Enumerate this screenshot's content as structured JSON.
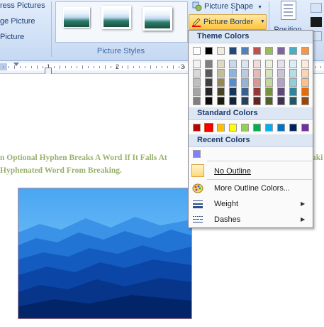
{
  "ribbon": {
    "left_commands": [
      "ress Pictures",
      "ge Picture",
      "Picture"
    ],
    "group_label": "Picture Styles",
    "picture_shape_label": "Picture Shape",
    "picture_border_label": "Picture Border",
    "position_label": "Position"
  },
  "ruler": {
    "numbers": [
      "1",
      "2",
      "3"
    ]
  },
  "document": {
    "line1": "n Optional Hyphen Breaks A Word If It Falls At",
    "line1_tail": "aki",
    "line2": "Hyphenated Word From Breaking.",
    "text_color": "#98b06e"
  },
  "menu": {
    "theme_header": "Theme Colors",
    "standard_header": "Standard Colors",
    "recent_header": "Recent Colors",
    "no_outline": "No Outline",
    "more_colors": "More Outline Colors...",
    "weight": "Weight",
    "dashes": "Dashes",
    "theme_base": [
      "#ffffff",
      "#000000",
      "#eeece1",
      "#1f497d",
      "#4f81bd",
      "#c0504d",
      "#9bbb59",
      "#8064a2",
      "#4bacc6",
      "#f79646"
    ],
    "theme_shades": [
      [
        "#f2f2f2",
        "#d8d8d8",
        "#bfbfbf",
        "#a5a5a5",
        "#7f7f7f"
      ],
      [
        "#7f7f7f",
        "#595959",
        "#3f3f3f",
        "#262626",
        "#0c0c0c"
      ],
      [
        "#ddd9c3",
        "#c4bd97",
        "#938953",
        "#494429",
        "#1d1b10"
      ],
      [
        "#c6d9f0",
        "#8db3e2",
        "#548dd4",
        "#17365d",
        "#0f243e"
      ],
      [
        "#dbe5f1",
        "#b8cce4",
        "#95b3d7",
        "#366092",
        "#244061"
      ],
      [
        "#f2dcdb",
        "#e5b9b7",
        "#d99694",
        "#953734",
        "#632423"
      ],
      [
        "#ebf1dd",
        "#d7e3bc",
        "#c3d69b",
        "#76923c",
        "#4f6128"
      ],
      [
        "#e5e0ec",
        "#ccc1d9",
        "#b2a2c7",
        "#5f497a",
        "#3f3151"
      ],
      [
        "#dbeef3",
        "#b7dde8",
        "#92cddc",
        "#31859b",
        "#205867"
      ],
      [
        "#fdeada",
        "#fbd5b5",
        "#fac08f",
        "#e36c09",
        "#974806"
      ]
    ],
    "standard_colors": [
      "#c00000",
      "#ff0000",
      "#ffc000",
      "#ffff00",
      "#92d050",
      "#00b050",
      "#00b0f0",
      "#0070c0",
      "#002060",
      "#7030a0"
    ],
    "selected_standard_index": 1,
    "recent_colors": [
      "#8080ff"
    ]
  }
}
